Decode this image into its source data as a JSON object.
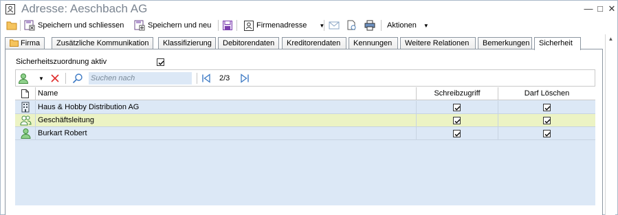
{
  "window": {
    "title": "Adresse: Aeschbach AG",
    "controls": {
      "minimize": "—",
      "maximize": "□",
      "close": "✕"
    }
  },
  "toolbar": {
    "save_close": "Speichern und schliessen",
    "save_new": "Speichern und neu",
    "company_address": "Firmenadresse",
    "actions": "Aktionen"
  },
  "tabs": [
    {
      "label": "Firma"
    },
    {
      "label": "Zusätzliche Kommunikation"
    },
    {
      "label": "Klassifizierung"
    },
    {
      "label": "Debitorendaten"
    },
    {
      "label": "Kreditorendaten"
    },
    {
      "label": "Kennungen"
    },
    {
      "label": "Weitere Relationen"
    },
    {
      "label": "Bemerkungen"
    },
    {
      "label": "Sicherheit",
      "active": true
    }
  ],
  "security": {
    "assignment_label": "Sicherheitszuordnung aktiv",
    "assignment_checked": true
  },
  "grid_toolbar": {
    "search_placeholder": "Suchen nach",
    "pager": "2/3"
  },
  "grid": {
    "columns": {
      "name": "Name",
      "write": "Schreibzugriff",
      "delete": "Darf Löschen"
    },
    "rows": [
      {
        "icon": "building-icon",
        "name": "Haus & Hobby Distribution AG",
        "write": true,
        "delete": true,
        "highlight": false
      },
      {
        "icon": "group-icon",
        "name": "Geschäftsleitung",
        "write": true,
        "delete": true,
        "highlight": true
      },
      {
        "icon": "user-icon",
        "name": "Burkart Robert",
        "write": true,
        "delete": true,
        "highlight": false
      }
    ]
  },
  "colors": {
    "row_highlight": "#ecf3c4",
    "grid_background": "#dce8f6",
    "title_text": "#7b8591"
  }
}
